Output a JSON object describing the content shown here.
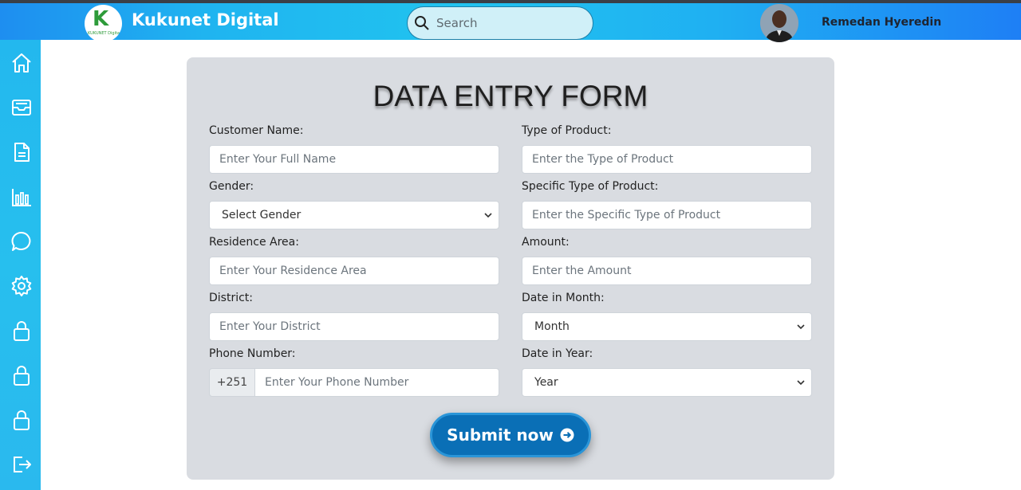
{
  "header": {
    "logo_letter": "K",
    "logo_subtext": "KUKUNET Digital",
    "brand": "Kukunet Digital",
    "search_placeholder": "Search",
    "user_name": "Remedan Hyeredin"
  },
  "sidebar": {
    "items": [
      {
        "icon": "home-icon"
      },
      {
        "icon": "inbox-icon"
      },
      {
        "icon": "document-icon"
      },
      {
        "icon": "bar-chart-icon"
      },
      {
        "icon": "chat-icon"
      },
      {
        "icon": "gear-icon"
      },
      {
        "icon": "lock-icon"
      },
      {
        "icon": "lock-icon"
      },
      {
        "icon": "lock-icon"
      },
      {
        "icon": "logout-icon"
      }
    ]
  },
  "form": {
    "title": "DATA ENTRY FORM",
    "customer_name": {
      "label": "Customer Name:",
      "placeholder": "Enter Your Full Name"
    },
    "gender": {
      "label": "Gender:",
      "value": "Select Gender"
    },
    "residence_area": {
      "label": "Residence Area:",
      "placeholder": "Enter Your Residence Area"
    },
    "district": {
      "label": "District:",
      "placeholder": "Enter Your District"
    },
    "phone": {
      "label": "Phone Number:",
      "prefix": "+251",
      "placeholder": "Enter Your Phone Number"
    },
    "product_type": {
      "label": "Type of Product:",
      "placeholder": "Enter the Type of Product"
    },
    "specific_product": {
      "label": "Specific Type of Product:",
      "placeholder": "Enter the Specific Type of Product"
    },
    "amount": {
      "label": "Amount:",
      "placeholder": "Enter the Amount"
    },
    "month": {
      "label": "Date in Month:",
      "value": "Month"
    },
    "year": {
      "label": "Date in Year:",
      "value": "Year"
    },
    "submit_label": "Submit now"
  },
  "colors": {
    "header_accent": "#21c3ef",
    "sidebar": "#27bfee",
    "submit": "#0a6fb6",
    "card": "#d9dce1"
  }
}
